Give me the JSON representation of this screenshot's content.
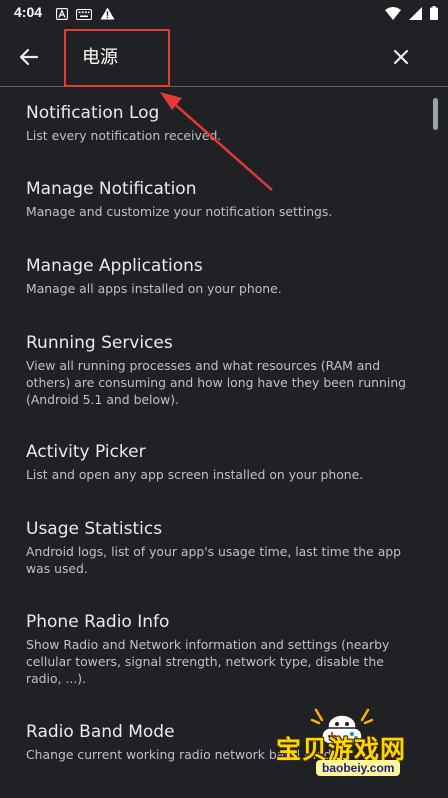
{
  "status_bar": {
    "time": "4:04",
    "left_icons": [
      "app-a-icon",
      "keyboard-icon",
      "warning-icon"
    ],
    "right_icons": [
      "wifi-icon",
      "signal-icon",
      "battery-icon"
    ]
  },
  "app_bar": {
    "search_query": "电源",
    "back_icon": "arrow-left-icon",
    "clear_icon": "close-icon"
  },
  "results": [
    {
      "title": "Notification Log",
      "description": "List every notification received."
    },
    {
      "title": "Manage Notification",
      "description": "Manage and customize your notification settings."
    },
    {
      "title": "Manage Applications",
      "description": "Manage all apps installed on your phone."
    },
    {
      "title": "Running Services",
      "description": "View all running processes and what resources (RAM and others) are consuming and how long have they been running (Android 5.1 and below)."
    },
    {
      "title": "Activity Picker",
      "description": "List and open any app screen installed on your phone."
    },
    {
      "title": "Usage Statistics",
      "description": "Android logs, list of your app's usage time, last time the app was used."
    },
    {
      "title": "Phone Radio Info",
      "description": "Show Radio and Network information and settings (nearby cellular towers, signal strength, network type, disable the radio, ...)."
    },
    {
      "title": "Radio Band Mode",
      "description": "Change current working radio network band mode"
    }
  ],
  "watermark": {
    "brand": "宝贝游戏网",
    "url": "baobeiy.com"
  },
  "colors": {
    "background": "#202124",
    "highlight": "#e53935",
    "text_primary": "#e8eaed",
    "text_secondary": "#bdc1c6"
  }
}
